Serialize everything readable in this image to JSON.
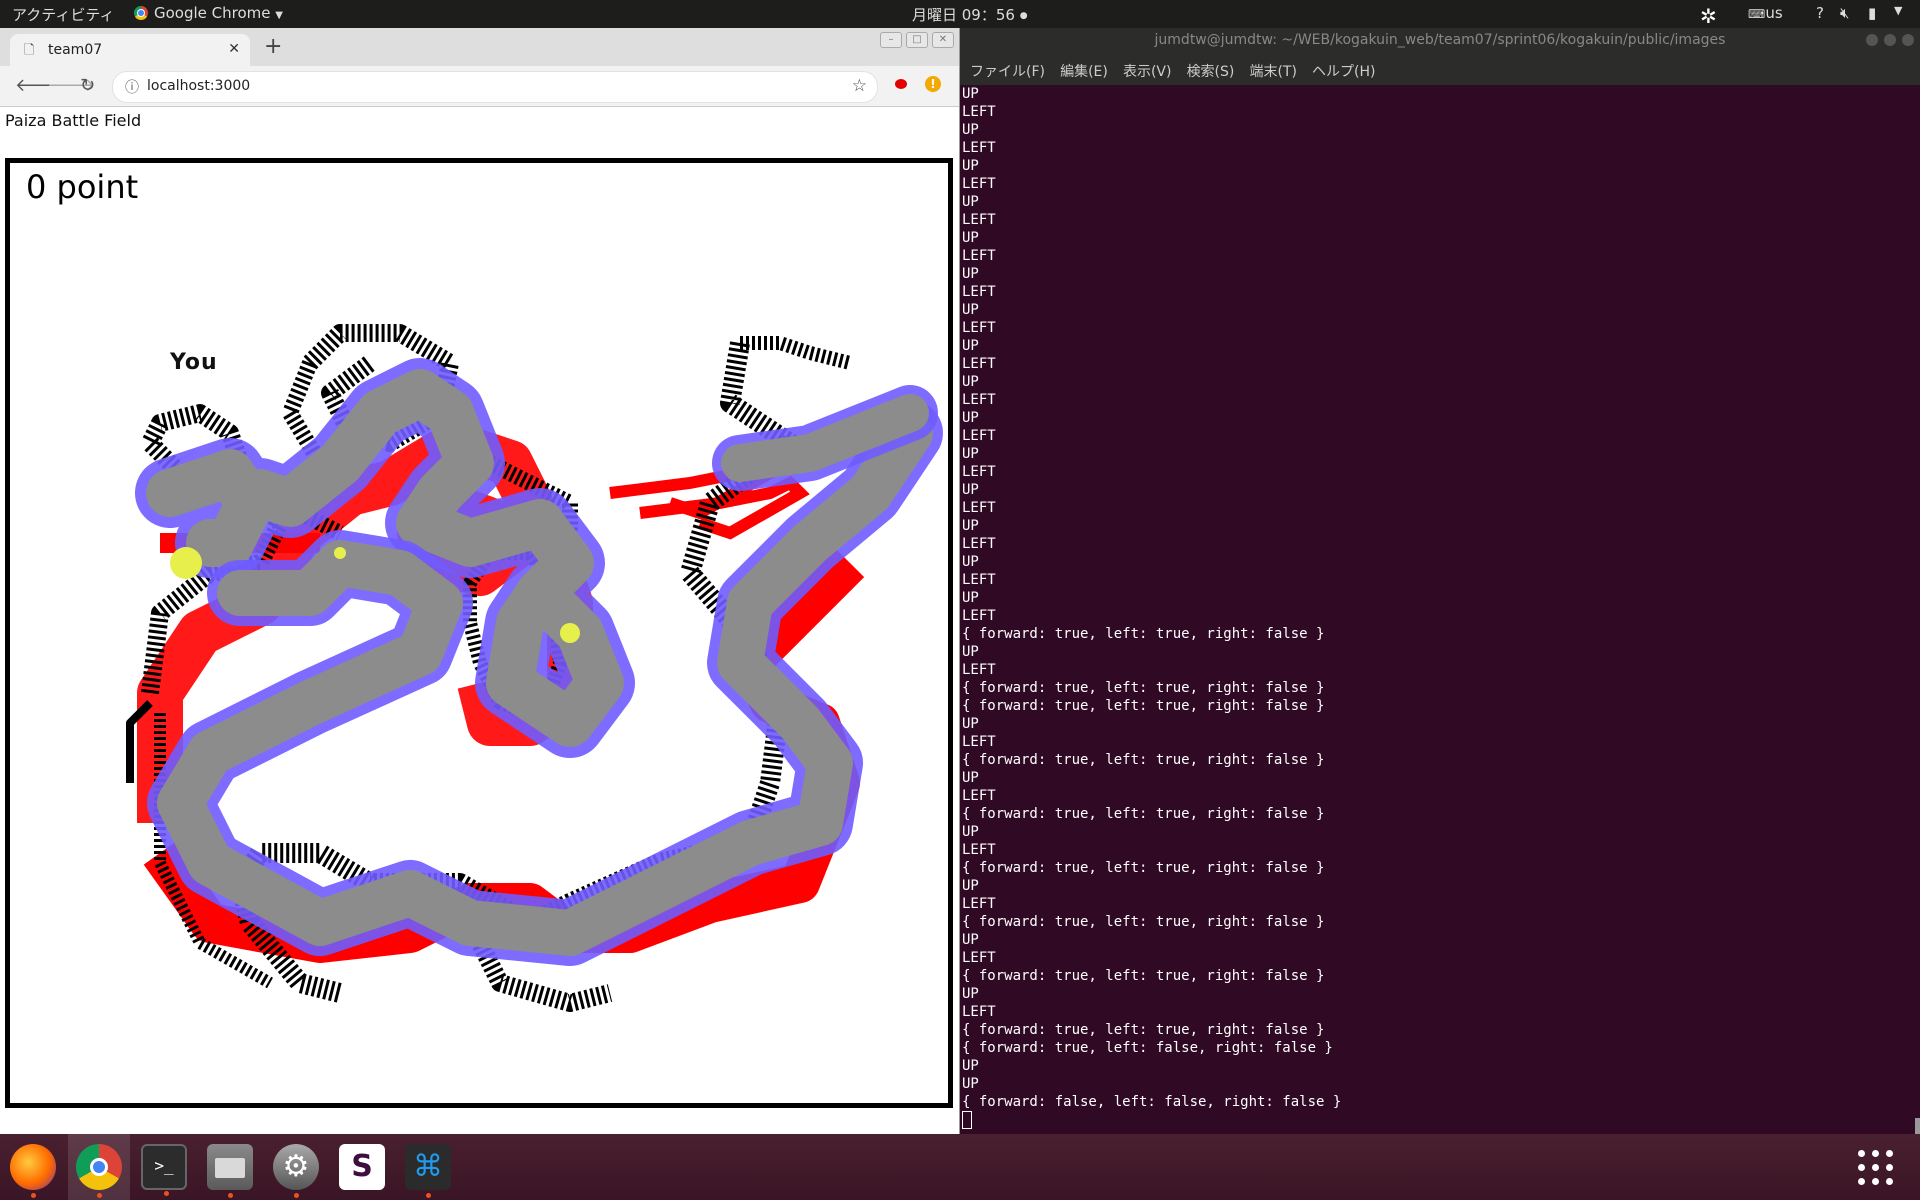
{
  "top_panel": {
    "activities": "アクティビティ",
    "app_menu": "Google Chrome",
    "clock": "月曜日 09：56",
    "keyboard_layout": "us",
    "help": "?"
  },
  "browser": {
    "tab_title": "team07",
    "new_tab": "+",
    "url": "localhost:3000",
    "page_heading": "Paiza Battle Field",
    "game": {
      "score": "0 point",
      "player_label": "You"
    }
  },
  "terminal": {
    "title": "jumdtw@jumdtw: ~/WEB/kogakuin_web/team07/sprint06/kogakuin/public/images",
    "menu": [
      "ファイル(F)",
      "編集(E)",
      "表示(V)",
      "検索(S)",
      "端末(T)",
      "ヘルプ(H)"
    ],
    "lines": [
      "UP",
      "LEFT",
      "UP",
      "LEFT",
      "UP",
      "LEFT",
      "UP",
      "LEFT",
      "UP",
      "LEFT",
      "UP",
      "LEFT",
      "UP",
      "LEFT",
      "UP",
      "LEFT",
      "UP",
      "LEFT",
      "UP",
      "LEFT",
      "UP",
      "LEFT",
      "UP",
      "LEFT",
      "UP",
      "LEFT",
      "UP",
      "LEFT",
      "UP",
      "LEFT",
      "{ forward: true, left: true, right: false }",
      "UP",
      "LEFT",
      "{ forward: true, left: true, right: false }",
      "{ forward: true, left: true, right: false }",
      "UP",
      "LEFT",
      "{ forward: true, left: true, right: false }",
      "UP",
      "LEFT",
      "{ forward: true, left: true, right: false }",
      "UP",
      "LEFT",
      "{ forward: true, left: true, right: false }",
      "UP",
      "LEFT",
      "{ forward: true, left: true, right: false }",
      "UP",
      "LEFT",
      "{ forward: true, left: true, right: false }",
      "UP",
      "LEFT",
      "{ forward: true, left: true, right: false }",
      "{ forward: true, left: false, right: false }",
      "UP",
      "UP",
      "{ forward: false, left: false, right: false }"
    ]
  },
  "dock": {
    "apps": [
      "firefox-icon",
      "chrome-icon",
      "terminal-icon",
      "files-icon",
      "settings-icon",
      "slack-icon",
      "vscode-icon"
    ]
  },
  "colors": {
    "terminal_bg": "#300a24",
    "trail_red": "#ff0000",
    "trail_gray": "#8c8c8c",
    "trail_blue": "#6f5cff",
    "trail_black": "#000000"
  }
}
